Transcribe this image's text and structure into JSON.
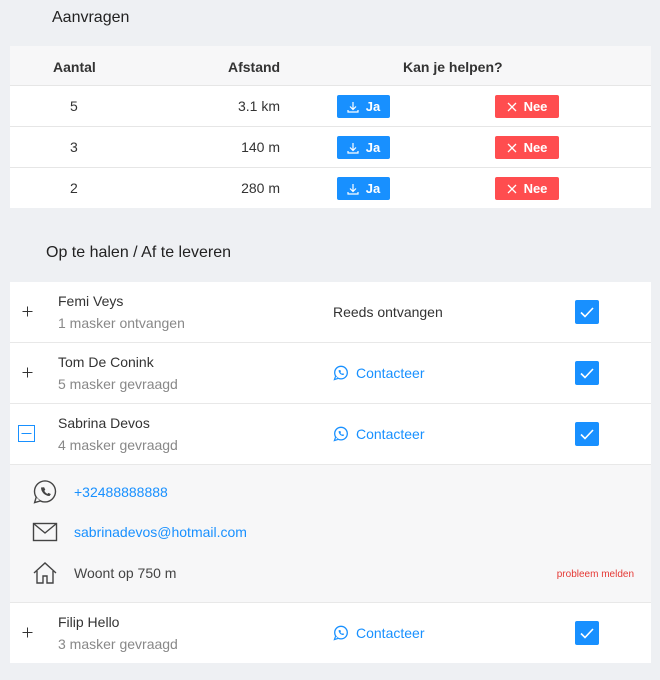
{
  "requests": {
    "title": "Aanvragen",
    "headers": {
      "count": "Aantal",
      "distance": "Afstand",
      "help": "Kan je helpen?"
    },
    "rows": [
      {
        "count": "5",
        "distance": "3.1 km",
        "yes": "Ja",
        "no": "Nee"
      },
      {
        "count": "3",
        "distance": "140 m",
        "yes": "Ja",
        "no": "Nee"
      },
      {
        "count": "2",
        "distance": "280 m",
        "yes": "Ja",
        "no": "Nee"
      }
    ]
  },
  "pickups": {
    "title": "Op te halen / Af te leveren",
    "items": [
      {
        "name": "Femi Veys",
        "sub": "1 masker ontvangen",
        "status": "Reeds ontvangen",
        "checked": true
      },
      {
        "name": "Tom De Conink",
        "sub": "5 masker gevraagd",
        "contact": "Contacteer",
        "checked": true
      },
      {
        "name": "Sabrina Devos",
        "sub": "4 masker gevraagd",
        "contact": "Contacteer",
        "checked": true,
        "expanded": true
      },
      {
        "name": "Filip Hello",
        "sub": "3 masker gevraagd",
        "contact": "Contacteer",
        "checked": true
      }
    ],
    "details": {
      "phone": "+32488888888",
      "email": "sabrinadevos@hotmail.com",
      "address": "Woont op 750 m",
      "report": "probleem melden"
    }
  },
  "colors": {
    "primary": "#1890ff",
    "danger": "#ff4d4f",
    "background": "#eef0f3"
  }
}
